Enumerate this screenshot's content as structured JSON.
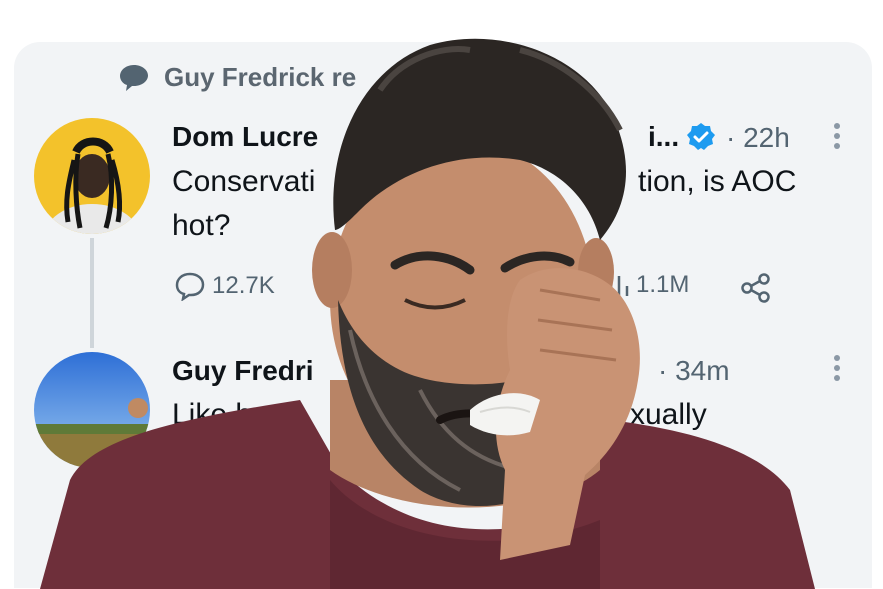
{
  "retweet_context": {
    "label": "Guy Fredrick re"
  },
  "tweet1": {
    "author": "Dom Lucre",
    "handle_trunc": "i...",
    "time": "· 22h",
    "text_line1_left": "Conservati",
    "text_line1_right": "tion, is AOC",
    "text_line2": "hot?",
    "replies": "12.7K",
    "views": "1.1M"
  },
  "tweet2": {
    "author": "Guy Fredri",
    "time": "· 34m",
    "text_left": "Like bo",
    "text_right": "xually"
  },
  "colors": {
    "verified": "#1d9bf0",
    "muted": "#536471",
    "shirt": "#6e2f3a"
  },
  "icons": [
    "comment-icon",
    "verified-badge-icon",
    "more-icon",
    "reply-icon",
    "retweet-icon",
    "views-icon",
    "share-icon"
  ]
}
